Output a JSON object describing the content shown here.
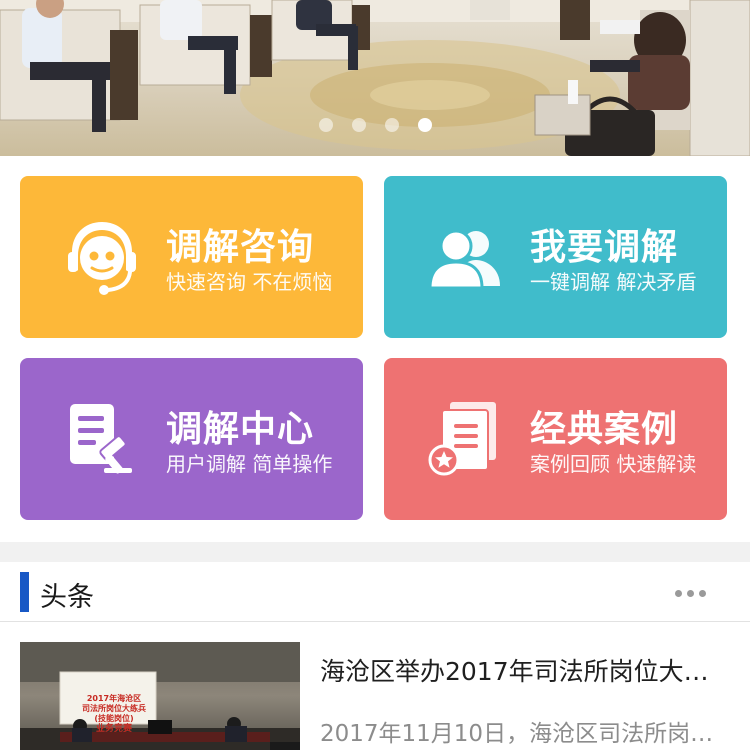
{
  "banner": {
    "image": "meeting-room-photo",
    "slide_count": 4,
    "active_slide": 4
  },
  "tiles": [
    {
      "title": "调解咨询",
      "subtitle": "快速咨询 不在烦恼",
      "icon": "headset-service-icon",
      "color": "#fdb839"
    },
    {
      "title": "我要调解",
      "subtitle": "一键调解 解决矛盾",
      "icon": "two-users-icon",
      "color": "#40bccb"
    },
    {
      "title": "调解中心",
      "subtitle": "用户调解 简单操作",
      "icon": "document-gavel-icon",
      "color": "#9b66cb"
    },
    {
      "title": "经典案例",
      "subtitle": "案例回顾 快速解读",
      "icon": "case-book-star-icon",
      "color": "#ee7272"
    }
  ],
  "news": {
    "section_title": "头条",
    "more_icon": "more-dots-icon",
    "accent_color": "#1858c5",
    "articles": [
      {
        "title": "海沧区举办2017年司法所岗位大…",
        "summary": "2017年11月10日，海沧区司法所岗…",
        "thumb_banner_line1": "2017年海沧区",
        "thumb_banner_line2": "司法所岗位大练兵 (技能岗位)",
        "thumb_banner_line3": "业务竞赛"
      }
    ]
  }
}
